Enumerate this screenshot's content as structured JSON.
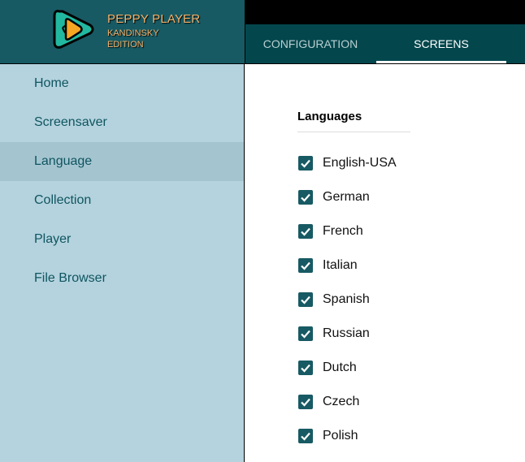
{
  "brand": {
    "title": "PEPPY PLAYER",
    "line2": "KANDINSKY",
    "line3": "EDITION"
  },
  "tabs": [
    {
      "label": "CONFIGURATION",
      "active": false
    },
    {
      "label": "SCREENS",
      "active": true
    }
  ],
  "sidebar": {
    "items": [
      {
        "label": "Home"
      },
      {
        "label": "Screensaver"
      },
      {
        "label": "Language",
        "selected": true
      },
      {
        "label": "Collection"
      },
      {
        "label": "Player"
      },
      {
        "label": "File Browser"
      }
    ]
  },
  "main": {
    "section_title": "Languages",
    "languages": [
      {
        "label": "English-USA",
        "checked": true
      },
      {
        "label": "German",
        "checked": true
      },
      {
        "label": "French",
        "checked": true
      },
      {
        "label": "Italian",
        "checked": true
      },
      {
        "label": "Spanish",
        "checked": true
      },
      {
        "label": "Russian",
        "checked": true
      },
      {
        "label": "Dutch",
        "checked": true
      },
      {
        "label": "Czech",
        "checked": true
      },
      {
        "label": "Polish",
        "checked": true
      }
    ]
  },
  "colors": {
    "header": "#175a63",
    "tabbar": "#03474d",
    "sidebar": "#b4d3de",
    "accent": "#175a63"
  }
}
